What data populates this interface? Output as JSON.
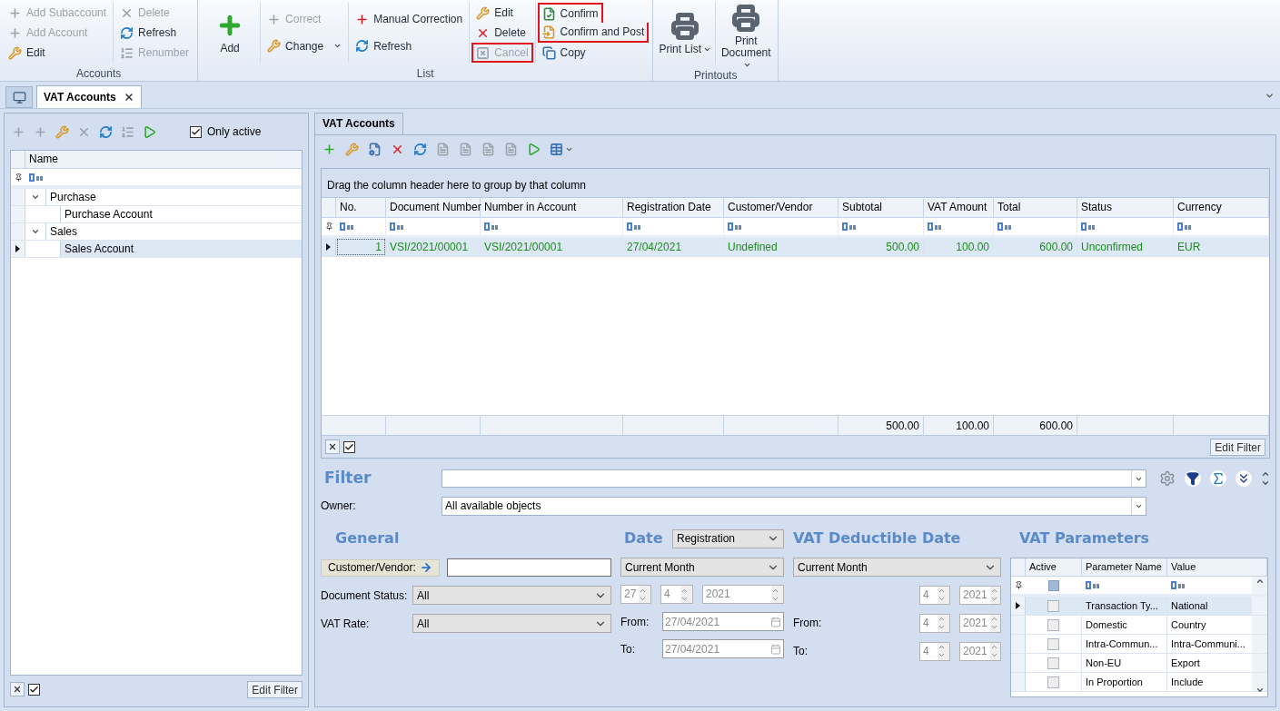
{
  "ribbon": {
    "groups": [
      {
        "label": "Accounts",
        "columns": [
          [
            {
              "kind": "small",
              "label": "Add Subaccount",
              "disabled": true,
              "highlighted": false,
              "dropdown": false
            },
            {
              "kind": "small",
              "label": "Add Account",
              "disabled": true,
              "highlighted": false,
              "dropdown": false
            },
            {
              "kind": "small",
              "label": "Edit",
              "disabled": false,
              "highlighted": false,
              "dropdown": false
            }
          ],
          [
            {
              "kind": "small",
              "label": "Delete",
              "disabled": true,
              "highlighted": false,
              "dropdown": false
            },
            {
              "kind": "small",
              "label": "Refresh",
              "disabled": false,
              "highlighted": false,
              "dropdown": false
            },
            {
              "kind": "small",
              "label": "Renumber",
              "disabled": true,
              "highlighted": false,
              "dropdown": false
            }
          ]
        ]
      },
      {
        "label": "List",
        "columns": [
          [
            {
              "kind": "large",
              "label": "Add",
              "disabled": false,
              "highlighted": false,
              "dropdown": false
            }
          ],
          [
            {
              "kind": "small",
              "label": "Correct",
              "disabled": true,
              "highlighted": false,
              "dropdown": false
            },
            {
              "kind": "small",
              "label": "Change",
              "disabled": false,
              "highlighted": false,
              "dropdown": true
            }
          ],
          [
            {
              "kind": "small",
              "label": "Manual Correction",
              "disabled": false,
              "highlighted": false,
              "dropdown": false
            },
            {
              "kind": "small",
              "label": "Refresh",
              "disabled": false,
              "highlighted": false,
              "dropdown": false
            }
          ],
          [
            {
              "kind": "small",
              "label": "Edit",
              "disabled": false,
              "highlighted": false,
              "dropdown": false
            },
            {
              "kind": "small",
              "label": "Delete",
              "disabled": false,
              "highlighted": false,
              "dropdown": false
            },
            {
              "kind": "small",
              "label": "Cancel",
              "disabled": true,
              "highlighted": true,
              "dropdown": false
            }
          ],
          [
            {
              "kind": "small",
              "label": "Confirm",
              "disabled": false,
              "highlighted": true,
              "dropdown": false
            },
            {
              "kind": "small",
              "label": "Confirm and Post",
              "disabled": false,
              "highlighted": true,
              "dropdown": false
            },
            {
              "kind": "small",
              "label": "Copy",
              "disabled": false,
              "highlighted": false,
              "dropdown": false
            }
          ]
        ]
      },
      {
        "label": "Printouts",
        "columns": [
          [
            {
              "kind": "large",
              "label": "Print List",
              "disabled": false,
              "highlighted": false,
              "dropdown": true
            }
          ],
          [
            {
              "kind": "large",
              "label": "Print Document",
              "disabled": false,
              "highlighted": false,
              "dropdown": true
            }
          ]
        ]
      }
    ]
  },
  "document_tabs": [
    {
      "label": "VAT Accounts",
      "selected": true
    }
  ],
  "accounts_panel": {
    "only_active": {
      "label": "Only active",
      "checked": true
    },
    "column": "Name",
    "tree": [
      {
        "label": "Purchase",
        "expanded": true,
        "selected": false,
        "children": [
          {
            "label": "Purchase Account",
            "selected": false
          }
        ]
      },
      {
        "label": "Sales",
        "expanded": true,
        "selected": false,
        "children": [
          {
            "label": "Sales Account",
            "selected": true
          }
        ]
      }
    ],
    "filter_checked": true,
    "edit_filter": "Edit Filter"
  },
  "list_panel": {
    "tab": "VAT Accounts",
    "group_hint": "Drag the column header here to group by that column",
    "columns": [
      {
        "label": "No.",
        "kind": "number"
      },
      {
        "label": "Document Number",
        "kind": "text"
      },
      {
        "label": "Number in Account",
        "kind": "text"
      },
      {
        "label": "Registration Date",
        "kind": "text"
      },
      {
        "label": "Customer/Vendor",
        "kind": "text"
      },
      {
        "label": "Subtotal",
        "kind": "number",
        "total": "500.00"
      },
      {
        "label": "VAT Amount",
        "kind": "number",
        "total": "100.00"
      },
      {
        "label": "Total",
        "kind": "number",
        "total": "600.00"
      },
      {
        "label": "Status",
        "kind": "text"
      },
      {
        "label": "Currency",
        "kind": "text"
      }
    ],
    "rows": [
      {
        "selected": true,
        "cells": [
          "1",
          "VSI/2021/00001",
          "VSI/2021/00001",
          "27/04/2021",
          "Undefined",
          "500.00",
          "100.00",
          "600.00",
          "Unconfirmed",
          "EUR"
        ]
      }
    ],
    "filter_checked": true,
    "edit_filter": "Edit Filter"
  },
  "filter": {
    "title": "Filter",
    "owner": {
      "label": "Owner:",
      "value": "All available objects"
    },
    "general": {
      "title": "General",
      "customer_button": "Customer/Vendor:",
      "document_status": {
        "label": "Document Status:",
        "value": "All"
      },
      "vat_rate": {
        "label": "VAT Rate:",
        "value": "All"
      }
    },
    "date": {
      "title": "Date",
      "disabled": true,
      "type": "Registration",
      "period": "Current Month",
      "day": "27",
      "month": "4",
      "year": "2021",
      "from": {
        "label": "From:",
        "value": "27/04/2021"
      },
      "to": {
        "label": "To:",
        "value": "27/04/2021"
      }
    },
    "deductible": {
      "title": "VAT Deductible Date",
      "disabled": true,
      "period": "Current Month",
      "rows": [
        {
          "month": "4",
          "year": "2021"
        },
        {
          "label": "From:",
          "month": "4",
          "year": "2021"
        },
        {
          "label": "To:",
          "month": "4",
          "year": "2021"
        }
      ]
    },
    "vat_parameters": {
      "title": "VAT Parameters",
      "filter_partial": true,
      "columns": [
        "Active",
        "Parameter Name",
        "Value"
      ],
      "rows": [
        {
          "active": false,
          "name": "Transaction Ty...",
          "value": "National",
          "selected": true
        },
        {
          "active": false,
          "name": "Domestic",
          "value": "Country",
          "selected": false
        },
        {
          "active": false,
          "name": "Intra-Commun...",
          "value": "Intra-Communi...",
          "selected": false
        },
        {
          "active": false,
          "name": "Non-EU",
          "value": "Export",
          "selected": false
        },
        {
          "active": false,
          "name": "In Proportion",
          "value": "Include",
          "selected": false
        }
      ]
    }
  }
}
